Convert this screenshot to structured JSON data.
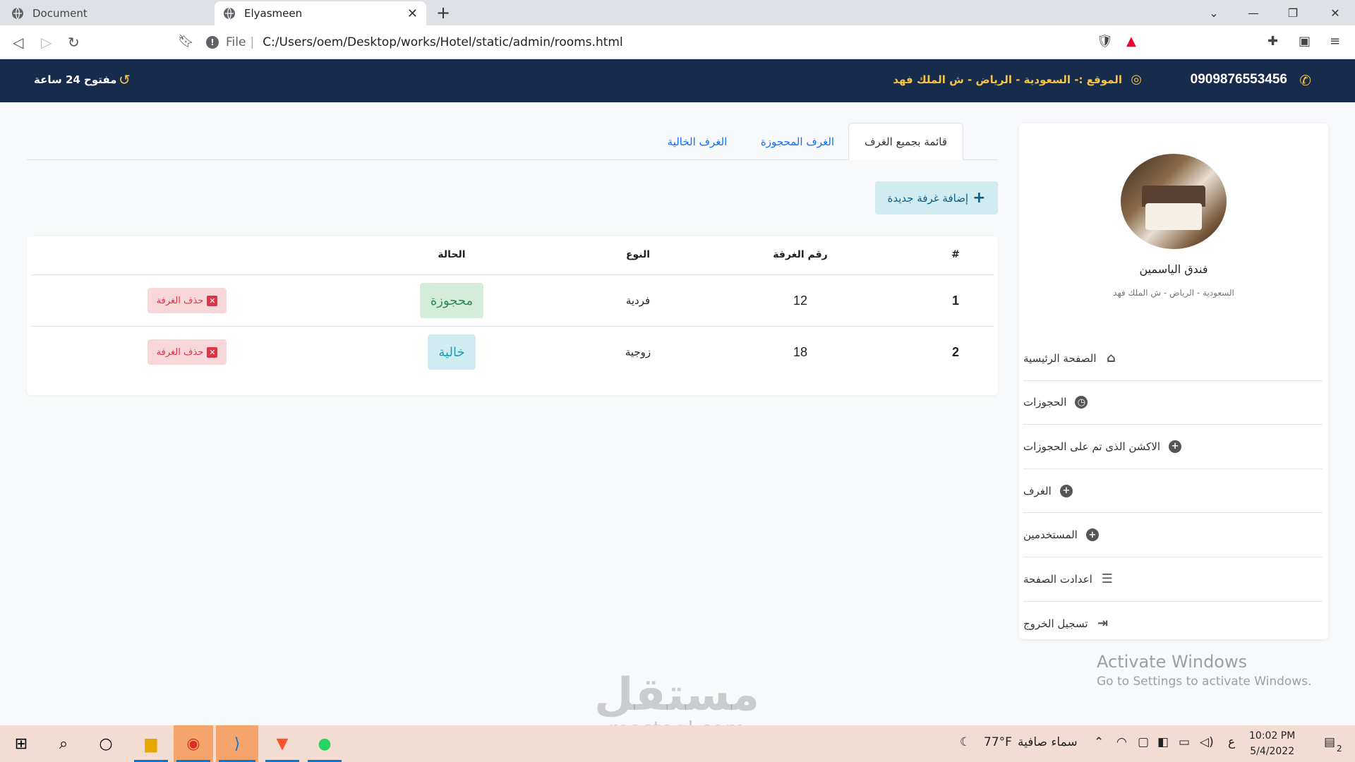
{
  "browser": {
    "tabs": [
      {
        "title": "Document"
      },
      {
        "title": "Elyasmeen"
      }
    ],
    "file_label": "File",
    "url": "C:/Users/oem/Desktop/works/Hotel/static/admin/rooms.html"
  },
  "topbar": {
    "phone": "0909876553456",
    "location": "الموقع :- السعودية - الرياض - ش الملك فهد",
    "hours": "مفتوح 24 ساعة"
  },
  "sidebar": {
    "hotel_name": "فندق الياسمين",
    "address": "السعودية - الرياض - ش الملك فهد",
    "menu": [
      {
        "label": "الصفحة الرئيسية",
        "icon": "home-icon"
      },
      {
        "label": "الحجوزات",
        "icon": "clock-icon"
      },
      {
        "label": "الاكشن الذى تم على الحجوزات",
        "icon": "plus-circle-icon"
      },
      {
        "label": "الغرف",
        "icon": "plus-circle-icon"
      },
      {
        "label": "المستخدمين",
        "icon": "plus-circle-icon"
      },
      {
        "label": "اعدادت الصفحة",
        "icon": "menu-icon"
      },
      {
        "label": "تسجيل الخروج",
        "icon": "logout-icon"
      }
    ]
  },
  "tabs": [
    {
      "label": "قائمة بجميع الغرف",
      "active": true
    },
    {
      "label": "الغرف المحجوزة",
      "active": false
    },
    {
      "label": "الغرف الخالية",
      "active": false
    }
  ],
  "add_button": "إضافة غرفة جديدة",
  "table": {
    "headers": [
      "#",
      "رقم الغرفة",
      "النوع",
      "الحالة"
    ],
    "rows": [
      {
        "index": "1",
        "room": "12",
        "type": "فردية",
        "status": "محجوزة",
        "status_kind": "booked",
        "delete": "حذف الغرفة"
      },
      {
        "index": "2",
        "room": "18",
        "type": "زوجية",
        "status": "خالية",
        "status_kind": "free",
        "delete": "حذف الغرفة"
      }
    ]
  },
  "windows": {
    "activate_title": "Activate Windows",
    "activate_sub": "Go to Settings to activate Windows."
  },
  "watermark": {
    "arabic": "مستقل",
    "latin": "mostaql.com"
  },
  "taskbar": {
    "weather_temp": "77°F",
    "weather_text": "سماء صافية",
    "lang": "ع",
    "time": "10:02 PM",
    "date": "5/4/2022",
    "notifications": "2"
  },
  "colors": {
    "topbar": "#172b4d",
    "accent": "#f6c344",
    "link": "#0d6efd"
  }
}
